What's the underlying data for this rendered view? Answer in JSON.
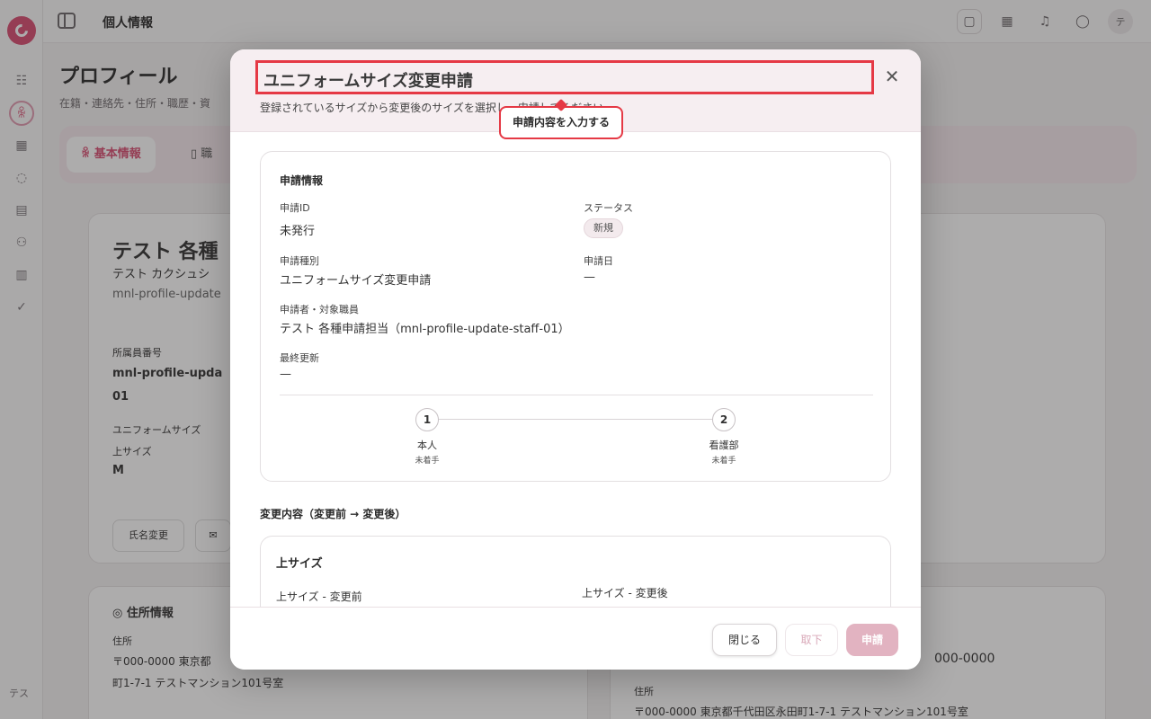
{
  "header": {
    "title": "個人情報",
    "avatar_initial": "テ"
  },
  "sidebar": {
    "user_initials": "テス"
  },
  "page": {
    "title": "プロフィール",
    "subtitle": "在籍・連絡先・住所・職歴・資",
    "tabs": [
      {
        "label": "基本情報"
      },
      {
        "label": "職"
      }
    ]
  },
  "background": {
    "name": "テスト 各種",
    "name_kana": "テスト カクシュシ",
    "staff_id_short": "mnl-profile-update",
    "staff_no_label": "所属員番号",
    "staff_no_value": "mnl-profile-upda",
    "staff_no_value2": "01",
    "uniform_label": "ユニフォームサイズ",
    "top_label": "上サイズ",
    "top_value": "M",
    "name_change_button": "氏名変更",
    "address_card_title": "住所情報",
    "address_label": "住所",
    "address_value": "〒000-0000 東京都",
    "address_value2": "町1-7-1 テストマンション101号室",
    "right_postal": "000-0000",
    "right_address_label": "住所",
    "right_address_value": "〒000-0000 東京都千代田区永田町1-7-1 テストマンション101号室"
  },
  "modal": {
    "title": "ユニフォームサイズ変更申請",
    "description": "登録されているサイズから変更後のサイズを選択し、申請してください。",
    "tooltip": "申請内容を入力する",
    "info_card": {
      "heading": "申請情報",
      "fields": {
        "id_label": "申請ID",
        "id_value": "未発行",
        "status_label": "ステータス",
        "status_value": "新規",
        "type_label": "申請種別",
        "type_value": "ユニフォームサイズ変更申請",
        "date_label": "申請日",
        "date_value": "—",
        "applicant_label": "申請者・対象職員",
        "applicant_value": "テスト 各種申請担当（mnl-profile-update-staff-01）",
        "updated_label": "最終更新",
        "updated_value": "—"
      },
      "steps": [
        {
          "number": "1",
          "name": "本人",
          "state": "未着手"
        },
        {
          "number": "2",
          "name": "看護部",
          "state": "未着手"
        }
      ]
    },
    "change_section_title": "変更内容（変更前 → 変更後）",
    "size_card": {
      "heading": "上サイズ",
      "before_label": "上サイズ - 変更前",
      "after_label": "上サイズ - 変更後"
    },
    "footer": {
      "close_label": "閉じる",
      "withdraw_label": "取下",
      "submit_label": "申請"
    }
  },
  "colors": {
    "accent": "#d94d72",
    "highlight": "#e53945",
    "submit_disabled": "#e2b3c1"
  }
}
